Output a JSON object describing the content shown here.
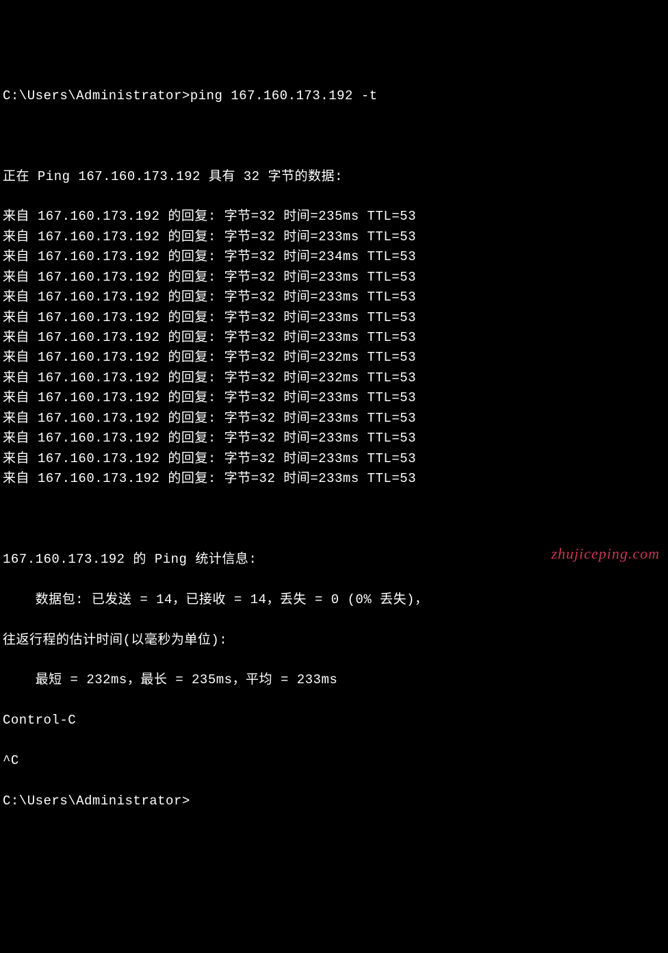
{
  "prompt": {
    "path": "C:\\Users\\Administrator>",
    "command": "ping 167.160.173.192 -t"
  },
  "header": "正在 Ping 167.160.173.192 具有 32 字节的数据:",
  "replies": [
    "来自 167.160.173.192 的回复: 字节=32 时间=235ms TTL=53",
    "来自 167.160.173.192 的回复: 字节=32 时间=233ms TTL=53",
    "来自 167.160.173.192 的回复: 字节=32 时间=234ms TTL=53",
    "来自 167.160.173.192 的回复: 字节=32 时间=233ms TTL=53",
    "来自 167.160.173.192 的回复: 字节=32 时间=233ms TTL=53",
    "来自 167.160.173.192 的回复: 字节=32 时间=233ms TTL=53",
    "来自 167.160.173.192 的回复: 字节=32 时间=233ms TTL=53",
    "来自 167.160.173.192 的回复: 字节=32 时间=232ms TTL=53",
    "来自 167.160.173.192 的回复: 字节=32 时间=232ms TTL=53",
    "来自 167.160.173.192 的回复: 字节=32 时间=233ms TTL=53",
    "来自 167.160.173.192 的回复: 字节=32 时间=233ms TTL=53",
    "来自 167.160.173.192 的回复: 字节=32 时间=233ms TTL=53",
    "来自 167.160.173.192 的回复: 字节=32 时间=233ms TTL=53",
    "来自 167.160.173.192 的回复: 字节=32 时间=233ms TTL=53"
  ],
  "stats": {
    "title": "167.160.173.192 的 Ping 统计信息:",
    "packets": "    数据包: 已发送 = 14，已接收 = 14，丢失 = 0 (0% 丢失)，",
    "rtt_label": "往返行程的估计时间(以毫秒为单位):",
    "rtt_values": "    最短 = 232ms，最长 = 235ms，平均 = 233ms"
  },
  "interrupt": {
    "label": "Control-C",
    "symbol": "^C"
  },
  "end_prompt": "C:\\Users\\Administrator>",
  "watermark": "zhujiceping.com"
}
